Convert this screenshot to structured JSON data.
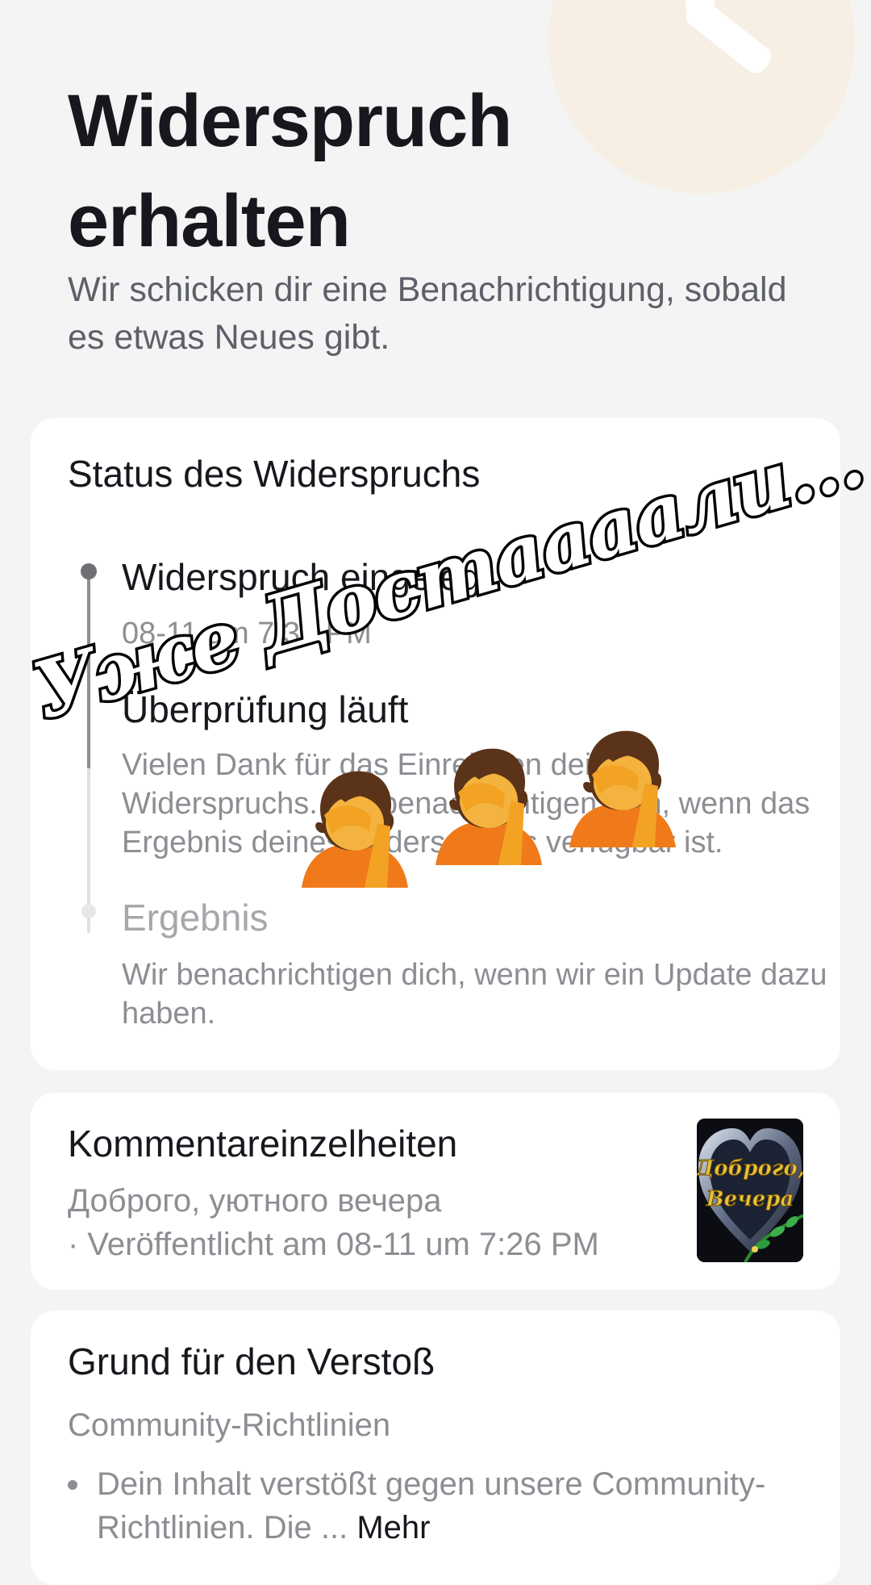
{
  "header": {
    "title": "Widerspruch erhalten",
    "subtitle": "Wir schicken dir eine Benachrichtigung, sobald es etwas Neues gibt."
  },
  "status": {
    "title": "Status des Widerspruchs",
    "steps": [
      {
        "title": "Widerspruch eingelegt",
        "meta": "08-11 um 7:32 PM"
      },
      {
        "title": "Überprüfung läuft",
        "desc": "Vielen Dank für das Einreichen deines Widerspruchs. Wir benachrichtigen dich, wenn das Ergebnis deines Widerspruchs verfügbar ist."
      },
      {
        "title": "Ergebnis",
        "desc": "Wir benachrichtigen dich, wenn wir ein Update dazu haben."
      }
    ]
  },
  "comment": {
    "title": "Kommentareinzelheiten",
    "text": "Доброго, уютного вечера",
    "published": "· Veröffentlicht am 08-11 um 7:26 PM",
    "thumbnail_caption": "Доброго, Вечера"
  },
  "reason": {
    "title": "Grund für den Verstoß",
    "category": "Community-Richtlinien",
    "bullet_text": "Dein Inhalt verstößt gegen unsere Community-Richtlinien. Die ...",
    "more_label": "Mehr"
  },
  "overlay": {
    "caption": "Уже Достаааали...",
    "emoji": "facepalm-person-emoji"
  },
  "colors": {
    "background": "#f4f4f5",
    "card": "#ffffff",
    "text_primary": "#16181d",
    "text_secondary": "#8c8e93",
    "clock_decor": "#f7efe3"
  }
}
